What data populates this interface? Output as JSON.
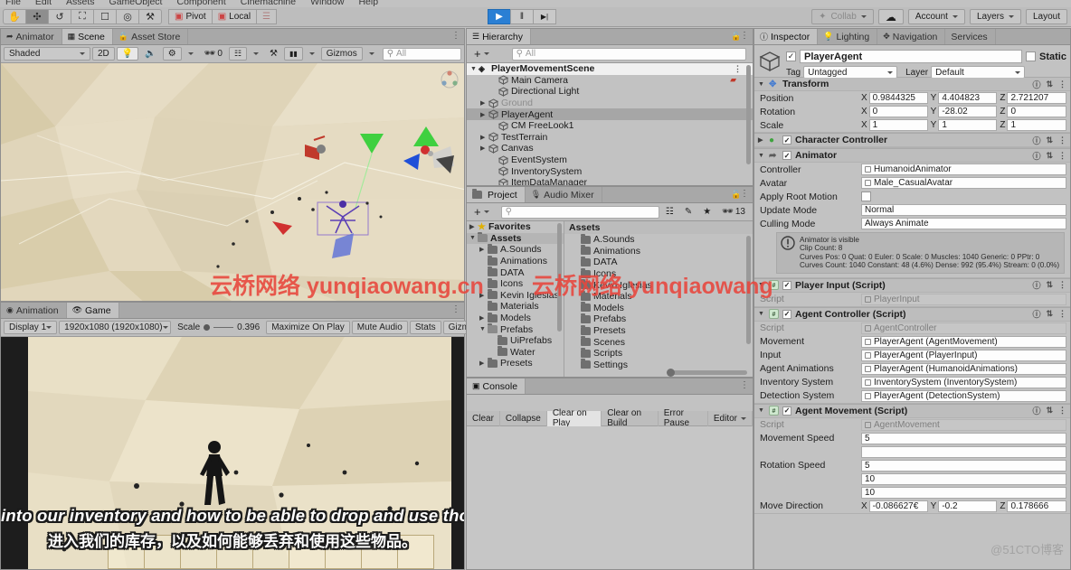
{
  "menubar": {
    "items": [
      "File",
      "Edit",
      "Assets",
      "GameObject",
      "Component",
      "Cinemachine",
      "Window",
      "Help"
    ]
  },
  "toolbar": {
    "tools": [
      "hand-tool",
      "move-tool",
      "rotate-tool",
      "scale-tool",
      "rect-tool",
      "transform-tool",
      "custom-tool"
    ],
    "pivot_label": "Pivot",
    "local_label": "Local",
    "play_label": "▶",
    "pause_label": "‖",
    "step_label": "▶|",
    "collab_label": "Collab",
    "account_label": "Account",
    "layers_label": "Layers",
    "layout_label": "Layout",
    "accent_color": "#2a7fd4"
  },
  "scene_panel": {
    "tabs": [
      {
        "label": "Animator",
        "active": false,
        "icon": "animator-icon"
      },
      {
        "label": "Scene",
        "active": true,
        "icon": "scene-icon"
      },
      {
        "label": "Asset Store",
        "active": false,
        "icon": "store-icon"
      }
    ],
    "toolbar": {
      "shading_mode": "Shaded",
      "mode_2d": "2D",
      "fx_count": "0",
      "gizmos_label": "Gizmos",
      "search_placeholder": "All"
    }
  },
  "game_panel": {
    "tabs": [
      {
        "label": "Animation",
        "active": false,
        "icon": "animation-icon"
      },
      {
        "label": "Game",
        "active": true,
        "icon": "game-icon"
      }
    ],
    "toolbar": {
      "display": "Display 1",
      "resolution": "1920x1080 (1920x1080)",
      "scale_label": "Scale",
      "scale_value": "0.396",
      "maximize_label": "Maximize On Play",
      "mute_label": "Mute Audio",
      "stats_label": "Stats",
      "gizmos_label": "Gizmos"
    },
    "subtitles": {
      "english": "into our inventory and how to be able to drop and use those items.",
      "chinese": "进入我们的库存，以及如何能够丢弃和使用这些物品。"
    }
  },
  "hierarchy": {
    "tab_label": "Hierarchy",
    "add_label": "+",
    "search_placeholder": "All",
    "items": [
      {
        "label": "PlayerMovementScene",
        "depth": 0,
        "expandable": true,
        "expanded": true,
        "kind": "scene",
        "selected": false,
        "disabled": false
      },
      {
        "label": "Main Camera",
        "depth": 2,
        "expandable": false,
        "expanded": false,
        "kind": "gameobject",
        "selected": false,
        "disabled": false
      },
      {
        "label": "Directional Light",
        "depth": 2,
        "expandable": false,
        "expanded": false,
        "kind": "gameobject",
        "selected": false,
        "disabled": false
      },
      {
        "label": "Ground",
        "depth": 1,
        "expandable": true,
        "expanded": false,
        "kind": "gameobject",
        "selected": false,
        "disabled": true
      },
      {
        "label": "PlayerAgent",
        "depth": 1,
        "expandable": true,
        "expanded": false,
        "kind": "gameobject",
        "selected": true,
        "disabled": false
      },
      {
        "label": "CM FreeLook1",
        "depth": 2,
        "expandable": false,
        "expanded": false,
        "kind": "gameobject",
        "selected": false,
        "disabled": false
      },
      {
        "label": "TestTerrain",
        "depth": 1,
        "expandable": true,
        "expanded": false,
        "kind": "gameobject",
        "selected": false,
        "disabled": false
      },
      {
        "label": "Canvas",
        "depth": 1,
        "expandable": true,
        "expanded": false,
        "kind": "gameobject",
        "selected": false,
        "disabled": false
      },
      {
        "label": "EventSystem",
        "depth": 2,
        "expandable": false,
        "expanded": false,
        "kind": "gameobject",
        "selected": false,
        "disabled": false
      },
      {
        "label": "InventorySystem",
        "depth": 2,
        "expandable": false,
        "expanded": false,
        "kind": "gameobject",
        "selected": false,
        "disabled": false
      },
      {
        "label": "ItemDataManager",
        "depth": 2,
        "expandable": false,
        "expanded": false,
        "kind": "gameobject",
        "selected": false,
        "disabled": false
      }
    ]
  },
  "project": {
    "tabs": [
      {
        "label": "Project",
        "active": true,
        "icon": "project-icon"
      },
      {
        "label": "Audio Mixer",
        "active": false,
        "icon": "audiomixer-icon"
      }
    ],
    "add_label": "+",
    "search_placeholder": "",
    "count_badge": "13",
    "tree": [
      {
        "label": "Favorites",
        "depth": 0,
        "expandable": true,
        "expanded": false,
        "kind": "favorite"
      },
      {
        "label": "Assets",
        "depth": 0,
        "expandable": true,
        "expanded": true,
        "kind": "folder-open",
        "selected": true
      },
      {
        "label": "A.Sounds",
        "depth": 1,
        "expandable": true,
        "expanded": false,
        "kind": "folder"
      },
      {
        "label": "Animations",
        "depth": 1,
        "expandable": false,
        "expanded": false,
        "kind": "folder"
      },
      {
        "label": "DATA",
        "depth": 1,
        "expandable": false,
        "expanded": false,
        "kind": "folder"
      },
      {
        "label": "Icons",
        "depth": 1,
        "expandable": false,
        "expanded": false,
        "kind": "folder"
      },
      {
        "label": "Kevin Iglesias",
        "depth": 1,
        "expandable": true,
        "expanded": false,
        "kind": "folder"
      },
      {
        "label": "Materials",
        "depth": 1,
        "expandable": false,
        "expanded": false,
        "kind": "folder"
      },
      {
        "label": "Models",
        "depth": 1,
        "expandable": true,
        "expanded": false,
        "kind": "folder"
      },
      {
        "label": "Prefabs",
        "depth": 1,
        "expandable": true,
        "expanded": true,
        "kind": "folder-open"
      },
      {
        "label": "UiPrefabs",
        "depth": 2,
        "expandable": false,
        "expanded": false,
        "kind": "folder"
      },
      {
        "label": "Water",
        "depth": 2,
        "expandable": false,
        "expanded": false,
        "kind": "folder"
      },
      {
        "label": "Presets",
        "depth": 1,
        "expandable": true,
        "expanded": false,
        "kind": "folder"
      }
    ],
    "content_header": "Assets",
    "content": [
      "A.Sounds",
      "Animations",
      "DATA",
      "Icons",
      "Kevin Iglesias",
      "Materials",
      "Models",
      "Prefabs",
      "Presets",
      "Scenes",
      "Scripts",
      "Settings"
    ]
  },
  "console": {
    "tab_label": "Console",
    "tools": [
      {
        "label": "Clear",
        "active": false
      },
      {
        "label": "Collapse",
        "active": false
      },
      {
        "label": "Clear on Play",
        "active": true
      },
      {
        "label": "Clear on Build",
        "active": false
      },
      {
        "label": "Error Pause",
        "active": false
      },
      {
        "label": "Editor",
        "active": false
      }
    ]
  },
  "inspector": {
    "tabs": [
      {
        "label": "Inspector",
        "active": true,
        "icon": "inspector-icon"
      },
      {
        "label": "Lighting",
        "active": false,
        "icon": "lighting-icon"
      },
      {
        "label": "Navigation",
        "active": false,
        "icon": "navigation-icon"
      },
      {
        "label": "Services",
        "active": false,
        "icon": "services-icon"
      }
    ],
    "object": {
      "enabled": true,
      "name": "PlayerAgent",
      "static_label": "Static",
      "static_checked": false,
      "tag_label": "Tag",
      "tag_value": "Untagged",
      "layer_label": "Layer",
      "layer_value": "Default"
    },
    "components": [
      {
        "name": "Transform",
        "icon": "transform-icon",
        "expanded": true,
        "has_enable": false,
        "enabled": true,
        "vectors": [
          {
            "label": "Position",
            "x": "0.9844325",
            "y": "4.404823",
            "z": "2.721207"
          },
          {
            "label": "Rotation",
            "x": "0",
            "y": "-28.02",
            "z": "0"
          },
          {
            "label": "Scale",
            "x": "1",
            "y": "1",
            "z": "1"
          }
        ]
      },
      {
        "name": "Character Controller",
        "icon": "charactercontroller-icon",
        "expanded": false,
        "has_enable": true,
        "enabled": true
      },
      {
        "name": "Animator",
        "icon": "animator-icon",
        "expanded": true,
        "has_enable": true,
        "enabled": true,
        "rows": [
          {
            "label": "Controller",
            "value": "HumanoidAnimator",
            "type": "object",
            "icon": "controller-icon"
          },
          {
            "label": "Avatar",
            "value": "Male_CasualAvatar",
            "type": "object",
            "icon": "avatar-icon"
          },
          {
            "label": "Apply Root Motion",
            "value": "",
            "type": "checkbox",
            "checked": false
          },
          {
            "label": "Update Mode",
            "value": "Normal",
            "type": "dropdown"
          },
          {
            "label": "Culling Mode",
            "value": "Always Animate",
            "type": "dropdown"
          }
        ],
        "helpbox": [
          "Animator is visible",
          "Clip Count: 8",
          "Curves Pos: 0 Quat: 0 Euler: 0 Scale: 0 Muscles: 1040 Generic: 0 PPtr: 0",
          "Curves Count: 1040 Constant: 48 (4.6%) Dense: 992 (95.4%) Stream: 0 (0.0%)"
        ]
      },
      {
        "name": "Player Input (Script)",
        "icon": "script-icon",
        "expanded": true,
        "has_enable": true,
        "enabled": true,
        "rows": [
          {
            "label": "Script",
            "value": "PlayerInput",
            "type": "object",
            "readonly": true
          }
        ]
      },
      {
        "name": "Agent Controller (Script)",
        "icon": "script-icon",
        "expanded": true,
        "has_enable": true,
        "enabled": true,
        "rows": [
          {
            "label": "Script",
            "value": "AgentController",
            "type": "object",
            "readonly": true
          },
          {
            "label": "Movement",
            "value": "PlayerAgent (AgentMovement)",
            "type": "object"
          },
          {
            "label": "Input",
            "value": "PlayerAgent (PlayerInput)",
            "type": "object"
          },
          {
            "label": "Agent Animations",
            "value": "PlayerAgent (HumanoidAnimations)",
            "type": "object"
          },
          {
            "label": "Inventory System",
            "value": "InventorySystem (InventorySystem)",
            "type": "object"
          },
          {
            "label": "Detection System",
            "value": "PlayerAgent (DetectionSystem)",
            "type": "object"
          }
        ]
      },
      {
        "name": "Agent Movement (Script)",
        "icon": "script-icon",
        "expanded": true,
        "has_enable": true,
        "enabled": true,
        "rows": [
          {
            "label": "Script",
            "value": "AgentMovement",
            "type": "object",
            "readonly": true
          },
          {
            "label": "Movement Speed",
            "value": "5",
            "type": "text"
          },
          {
            "label": "",
            "value": "",
            "type": "text"
          },
          {
            "label": "Rotation Speed",
            "value": "5",
            "type": "text"
          },
          {
            "label": "",
            "value": "10",
            "type": "text"
          },
          {
            "label": "",
            "value": "10",
            "type": "text"
          }
        ],
        "vectors": [
          {
            "label": "Move Direction",
            "x": "-0.086627€",
            "y": "-0.2",
            "z": "0.178666"
          }
        ]
      }
    ]
  },
  "watermarks": {
    "left": "云桥网络 yunqiaowang.cn",
    "right": "云桥网络 yunqiaowang",
    "corner": "@51CTO博客"
  }
}
